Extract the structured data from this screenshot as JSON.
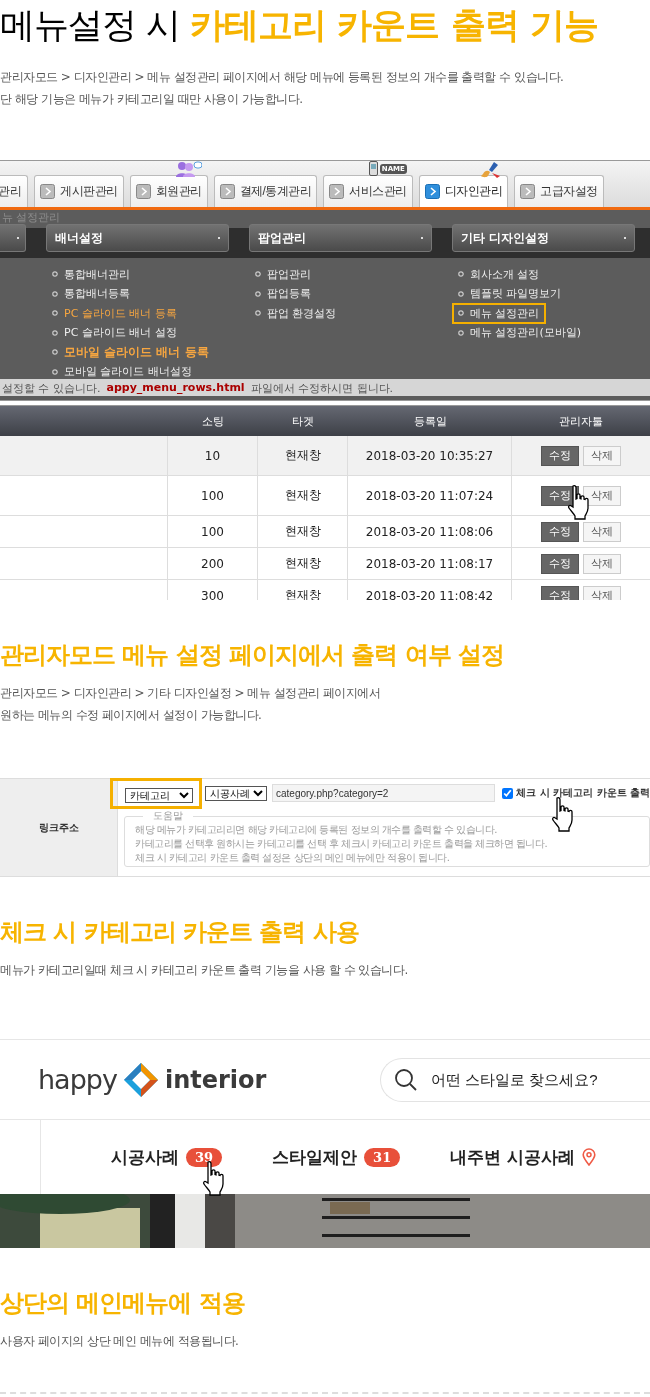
{
  "title": {
    "text": "메뉴설정 시",
    "highlight": "카테고리 카운트 출력 기능"
  },
  "intro": [
    "관리자모드 > 디자인관리 > 메뉴 설정관리 페이지에서 해당 메뉴에 등록된 정보의 개수를 출력할 수 있습니다.",
    "단 해당 기능은 메뉴가 카테고리일 때만 사용이 가능합니다."
  ],
  "admin_menu": {
    "tabs": [
      {
        "label": "관리",
        "selected": false
      },
      {
        "label": "게시판관리",
        "selected": false
      },
      {
        "label": "회원관리",
        "selected": false
      },
      {
        "label": "결제/통계관리",
        "selected": false
      },
      {
        "label": "서비스관리",
        "selected": false,
        "icon_text": "NAME"
      },
      {
        "label": "디자인관리",
        "selected": true
      },
      {
        "label": "고급자설정",
        "selected": false
      }
    ],
    "page_behind": {
      "breadcrumb": "뉴 설정관리",
      "note": "설정할 수 있습니다.",
      "file": "appy_menu_rows.html",
      "file_note": "파일에서 수정하시면 됩니다."
    },
    "columns": [
      {
        "heading": "배너설정",
        "items": [
          {
            "label": "통합배너관리",
            "kind": "plain",
            "boxed": false
          },
          {
            "label": "통합배너등록",
            "kind": "plain",
            "boxed": false
          },
          {
            "label": "PC 슬라이드 배너 등록",
            "kind": "accent",
            "boxed": false
          },
          {
            "label": "PC 슬라이드 배너 설정",
            "kind": "plain",
            "boxed": false
          },
          {
            "label": "모바일 슬라이드 배너 등록",
            "kind": "strong",
            "boxed": false
          },
          {
            "label": "모바일 슬라이드 배너설정",
            "kind": "plain",
            "boxed": false
          }
        ]
      },
      {
        "heading": "팝업관리",
        "items": [
          {
            "label": "팝업관리",
            "kind": "plain",
            "boxed": false
          },
          {
            "label": "팝업등록",
            "kind": "plain",
            "boxed": false
          },
          {
            "label": "팝업 환경설정",
            "kind": "plain",
            "boxed": false
          }
        ]
      },
      {
        "heading": "기타 디자인설정",
        "items": [
          {
            "label": "회사소개 설정",
            "kind": "plain",
            "boxed": false
          },
          {
            "label": "템플릿 파일명보기",
            "kind": "plain",
            "boxed": false
          },
          {
            "label": "메뉴 설정관리",
            "kind": "plain",
            "boxed": true
          },
          {
            "label": "메뉴 설정관리(모바일)",
            "kind": "plain",
            "boxed": false
          }
        ]
      }
    ]
  },
  "menu_table": {
    "headings": [
      "소팅",
      "타겟",
      "등록일",
      "관리자툴"
    ],
    "rows": [
      {
        "sort": "10",
        "target": "현재창",
        "date": "2018-03-20 10:35:27",
        "edit": "수정",
        "delete": "삭제",
        "selected": true
      },
      {
        "sort": "100",
        "target": "현재창",
        "date": "2018-03-20 11:07:24",
        "edit": "수정",
        "delete": "삭제",
        "selected": false
      },
      {
        "sort": "100",
        "target": "현재창",
        "date": "2018-03-20 11:08:06",
        "edit": "수정",
        "delete": "삭제",
        "selected": false
      },
      {
        "sort": "200",
        "target": "현재창",
        "date": "2018-03-20 11:08:17",
        "edit": "수정",
        "delete": "삭제",
        "selected": false
      },
      {
        "sort": "300",
        "target": "현재창",
        "date": "2018-03-20 11:08:42",
        "edit": "수정",
        "delete": "삭제",
        "selected": false
      }
    ]
  },
  "section_admin": {
    "heading": "관리자모드  메뉴 설정 페이지에서 출력 여부 설정",
    "lines": [
      "관리자모드 > 디자인관리 > 기타 디자인설정 > 메뉴 설정관리 페이지에서",
      "원하는 메뉴의 수정 페이지에서 설정이 가능합니다."
    ]
  },
  "link_form": {
    "label": "링크주소",
    "type_select": "카테고리",
    "type_highlighted": true,
    "category_select": "시공사례",
    "url": "category.php?category=2",
    "count_checkbox": {
      "label": "체크 시 카테고리 카운트 출력",
      "checked": true
    },
    "help": {
      "legend": "도움말",
      "lines": [
        "해당 메뉴가 카테고리리면 해당 카테고리에 등록된 정보의 개수를 출력할 수 있습니다.",
        "카테고리를 선택후 원하시는 카테고리를 선택 후 체크시 카테고리 카운트 출력을 체크하면 됩니다.",
        "체크 시 카테고리 카운트 출력 설정은 상단의 메인 메뉴에만 적용이 됩니다."
      ]
    }
  },
  "section_check": {
    "heading": "체크 시 카테고리 카운트 출력 사용",
    "lines": [
      "메뉴가 카테고리일때 체크 시 카테고리 카운트 출력 기능을 사용 할 수 있습니다."
    ]
  },
  "site_header": {
    "logo": {
      "left": "happy",
      "right": "interior"
    },
    "search": {
      "placeholder": "어떤 스타일로 찾으세요?"
    },
    "nav": [
      {
        "label": "시공사례",
        "kind": "count",
        "count": "39"
      },
      {
        "label": "스타일제안",
        "kind": "count",
        "count": "31"
      },
      {
        "label": "내주변 시공사례",
        "kind": "location"
      }
    ]
  },
  "section_apply": {
    "heading": "상단의 메인메뉴에 적용",
    "lines": [
      "사용자 페이지의 상단 메인 메뉴에 적용됩니다."
    ]
  }
}
